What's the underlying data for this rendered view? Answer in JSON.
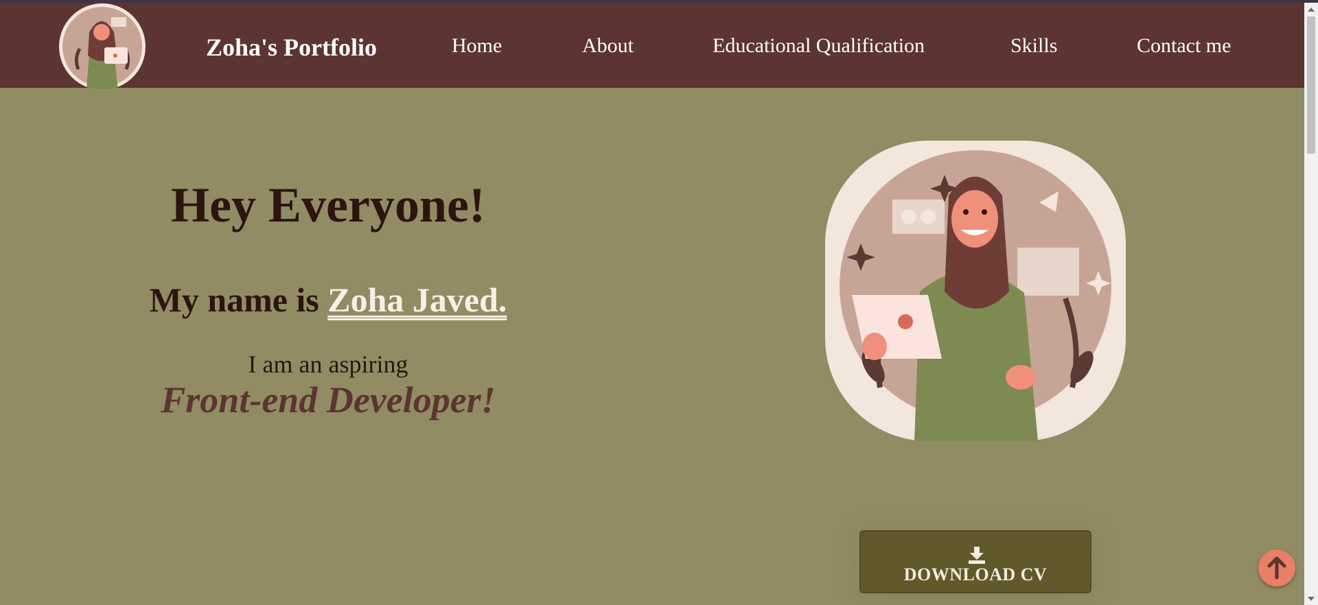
{
  "navbar": {
    "brand": "Zoha's Portfolio",
    "links": [
      {
        "label": "Home"
      },
      {
        "label": "About"
      },
      {
        "label": "Educational Qualification"
      },
      {
        "label": "Skills"
      },
      {
        "label": "Contact me"
      }
    ],
    "background_color": "#5c3431"
  },
  "hero": {
    "greeting": "Hey Everyone!",
    "name_prefix": "My name is ",
    "name": "Zoha Javed.",
    "aspiring": "I am an aspiring",
    "role": "Front-end Developer!",
    "background_color": "#918c63"
  },
  "download": {
    "label": "DOWNLOAD CV",
    "icon": "download-icon",
    "background_color": "#61592a"
  },
  "scroll_top": {
    "icon": "arrow-up-icon",
    "background_color": "#e87f66"
  },
  "portrait": {
    "alt_icon": "woman-with-laptop-illustration"
  }
}
